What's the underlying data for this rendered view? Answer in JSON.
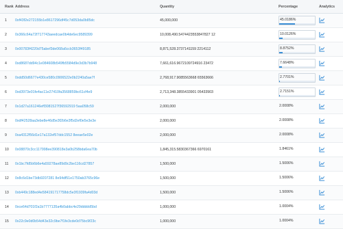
{
  "headers": {
    "rank": "Rank",
    "address": "Address",
    "quantity": "Quantity",
    "percentage": "Percentage",
    "analytics": "Analytics"
  },
  "icon": "chart-line-icon",
  "accent": "#3498db",
  "rows": [
    {
      "rank": "1",
      "address": "0xf43f2e272155b1e8617296df45c7d053da0b85dc",
      "quantity": "45,000,000",
      "pct_label": "45.0186%",
      "pct": 45.0186
    },
    {
      "rank": "2",
      "address": "0x366c64a72f717743aeedcae0b4de6ec9589399",
      "quantity": "10,008,490.5474423553847827 12",
      "pct_label": "10.0126%",
      "pct": 10.0126
    },
    {
      "rank": "3",
      "address": "0x00783f4220d75abef3de068a6ccb3653f49185",
      "quantity": "8,871,528.3737141159 2214112",
      "pct_label": "8.8752%",
      "pct": 8.8752
    },
    {
      "rank": "4",
      "address": "0xd8687dd94c1e084608b549fb5584d9e3d3b7b948",
      "quantity": "7,661,616.9672109724916 23472",
      "pct_label": "7.6648%",
      "pct": 7.6648
    },
    {
      "rank": "5",
      "address": "0xdd50d6677e430ce580c0906522e0b2240a5ae7f",
      "quantity": "2,768,917.9085563668 65563666",
      "pct_label": "2.7701%",
      "pct": 2.7701
    },
    {
      "rank": "6",
      "address": "0xd3973e01fe4ac11e27410fa3568859bc61cf4e9",
      "quantity": "2,713,348.3855433901 05433903",
      "pct_label": "2.7151%",
      "pct": 2.7151
    },
    {
      "rank": "7",
      "address": "0x1d27a161246eff3081527f36592919 5aa058c59",
      "quantity": "2,000,000",
      "pct_label": "2.0008%",
      "pct": 2.0008
    },
    {
      "rank": "8",
      "address": "0xdf42528aa3ebe8e46d5e3f2b6e3f5d2ef0e5e3e3e",
      "quantity": "2,000,000",
      "pct_label": "2.0008%",
      "pct": 2.0008
    },
    {
      "rank": "9",
      "address": "0xa4312f56d1e17a132ef57ddc1552 8eeae5e02e",
      "quantity": "2,000,000",
      "pct_label": "2.0008%",
      "pct": 2.0008
    },
    {
      "rank": "10",
      "address": "0x08870c3cc117998ee390818e3a0b258bda6ea70b",
      "quantity": "1,845,315.5830367366 6970161",
      "pct_label": "1.8461%",
      "pct": 1.8461
    },
    {
      "rank": "11",
      "address": "0x1bc7fd5b6b6e4a59278ae89d9c2be116cd27857",
      "quantity": "1,500,000",
      "pct_label": "1.5006%",
      "pct": 1.5006
    },
    {
      "rank": "12",
      "address": "0x8c6d1be73db9207281 8e94df51e1750ab3765c96e",
      "quantity": "1,500,000",
      "pct_label": "1.5006%",
      "pct": 1.5006
    },
    {
      "rank": "13",
      "address": "0xb449c188ed4e584191717758dc5e3f1939fa4d03d",
      "quantity": "1,500,000",
      "pct_label": "1.5006%",
      "pct": 1.5006
    },
    {
      "rank": "14",
      "address": "0xce64d701f2a1b7777135a4b0abbc4e29ddddd5bd",
      "quantity": "1,000,000",
      "pct_label": "1.0004%",
      "pct": 1.0004
    },
    {
      "rank": "15",
      "address": "0x22c9e0d0b54d43e32c9be7f1fe3cde0d75bc9f23c",
      "quantity": "1,000,000",
      "pct_label": "1.0004%",
      "pct": 1.0004
    }
  ]
}
